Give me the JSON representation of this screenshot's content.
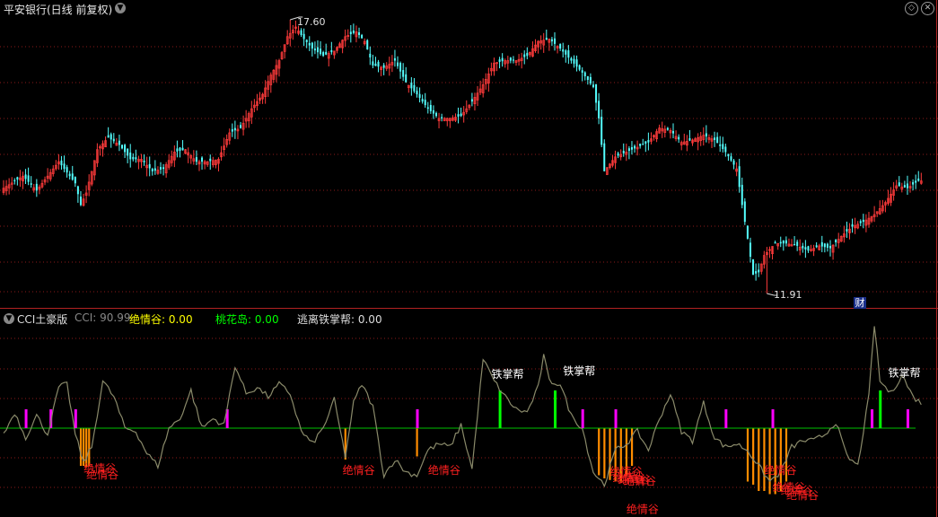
{
  "top": {
    "title": "平安银行(日线 前复权)",
    "high_label": "17.60",
    "low_label": "11.91",
    "fin_badge": "财",
    "corner_icons": [
      "diamond-icon",
      "close-icon"
    ]
  },
  "indicator": {
    "name": "CCI土豪版",
    "cci_label": "CCI: 90.99",
    "jqg_label": "绝情谷: 0.00",
    "thd_label": "桃花岛: 0.00",
    "tzb_label": "逃离铁掌帮: 0.00",
    "annot_jqg": "绝情谷",
    "annot_tzb": "铁掌帮"
  },
  "colors": {
    "bg": "#000000",
    "up": "#ff3b3b",
    "down": "#54ffff",
    "grid": "#8b1a1a",
    "cci_line": "#8a8a6a",
    "zero_line": "#00c000",
    "magenta": "#ff00ff",
    "green_bar": "#00ff00",
    "orange_bar": "#ff8c00",
    "jqg_text": "#ff2020",
    "tzb_text": "#ffffff",
    "cci_text": "#888888",
    "jqg_hdr": "#ffff00",
    "thd_hdr": "#00ff00",
    "tzb_hdr": "#dddddd"
  },
  "chart_data": {
    "type": "candlestick",
    "price_extremes": {
      "high": 17.6,
      "low": 11.91
    },
    "price_anchors": [
      [
        0,
        14.1
      ],
      [
        7,
        14.35
      ],
      [
        12,
        14.05
      ],
      [
        16,
        14.35
      ],
      [
        20,
        14.65
      ],
      [
        22,
        14.5
      ],
      [
        26,
        14.2
      ],
      [
        28,
        13.75
      ],
      [
        30,
        14.0
      ],
      [
        34,
        14.9
      ],
      [
        38,
        15.15
      ],
      [
        42,
        15.0
      ],
      [
        46,
        14.7
      ],
      [
        50,
        14.7
      ],
      [
        54,
        14.45
      ],
      [
        58,
        14.5
      ],
      [
        62,
        14.85
      ],
      [
        66,
        14.9
      ],
      [
        70,
        14.65
      ],
      [
        74,
        14.65
      ],
      [
        78,
        14.7
      ],
      [
        82,
        15.25
      ],
      [
        86,
        15.35
      ],
      [
        90,
        15.75
      ],
      [
        94,
        16.05
      ],
      [
        97,
        16.45
      ],
      [
        100,
        16.75
      ],
      [
        103,
        17.25
      ],
      [
        106,
        17.45
      ],
      [
        109,
        17.2
      ],
      [
        112,
        17.0
      ],
      [
        116,
        16.85
      ],
      [
        120,
        16.95
      ],
      [
        124,
        17.25
      ],
      [
        128,
        17.35
      ],
      [
        131,
        17.15
      ],
      [
        134,
        16.65
      ],
      [
        138,
        16.6
      ],
      [
        142,
        16.75
      ],
      [
        146,
        16.3
      ],
      [
        150,
        16.05
      ],
      [
        154,
        15.75
      ],
      [
        158,
        15.55
      ],
      [
        162,
        15.55
      ],
      [
        166,
        15.6
      ],
      [
        170,
        15.9
      ],
      [
        174,
        16.25
      ],
      [
        178,
        16.7
      ],
      [
        182,
        16.75
      ],
      [
        186,
        16.75
      ],
      [
        190,
        16.85
      ],
      [
        194,
        17.15
      ],
      [
        198,
        17.2
      ],
      [
        202,
        17.0
      ],
      [
        206,
        16.75
      ],
      [
        210,
        16.5
      ],
      [
        214,
        16.2
      ],
      [
        216,
        15.55
      ],
      [
        218,
        14.45
      ],
      [
        222,
        14.75
      ],
      [
        226,
        14.85
      ],
      [
        230,
        14.95
      ],
      [
        234,
        15.05
      ],
      [
        238,
        15.35
      ],
      [
        242,
        15.3
      ],
      [
        246,
        15.05
      ],
      [
        250,
        15.1
      ],
      [
        254,
        15.2
      ],
      [
        258,
        15.1
      ],
      [
        262,
        14.85
      ],
      [
        266,
        14.5
      ],
      [
        268,
        13.75
      ],
      [
        270,
        13.05
      ],
      [
        272,
        12.3
      ],
      [
        274,
        12.35
      ],
      [
        276,
        12.7
      ],
      [
        280,
        12.95
      ],
      [
        284,
        12.95
      ],
      [
        288,
        12.9
      ],
      [
        292,
        12.8
      ],
      [
        296,
        12.9
      ],
      [
        300,
        12.85
      ],
      [
        304,
        13.1
      ],
      [
        308,
        13.3
      ],
      [
        312,
        13.4
      ],
      [
        316,
        13.55
      ],
      [
        320,
        13.8
      ],
      [
        324,
        14.15
      ],
      [
        328,
        14.1
      ],
      [
        332,
        14.25
      ]
    ],
    "cci_anchors": [
      [
        0,
        -20
      ],
      [
        4,
        50
      ],
      [
        8,
        -30
      ],
      [
        12,
        40
      ],
      [
        16,
        -20
      ],
      [
        20,
        130
      ],
      [
        23,
        140
      ],
      [
        26,
        -20
      ],
      [
        29,
        -110
      ],
      [
        32,
        -60
      ],
      [
        36,
        150
      ],
      [
        40,
        100
      ],
      [
        44,
        0
      ],
      [
        48,
        -10
      ],
      [
        52,
        -80
      ],
      [
        56,
        -120
      ],
      [
        60,
        0
      ],
      [
        64,
        30
      ],
      [
        68,
        120
      ],
      [
        72,
        0
      ],
      [
        76,
        30
      ],
      [
        80,
        10
      ],
      [
        84,
        200
      ],
      [
        88,
        110
      ],
      [
        92,
        130
      ],
      [
        96,
        100
      ],
      [
        100,
        140
      ],
      [
        104,
        110
      ],
      [
        108,
        -10
      ],
      [
        112,
        -50
      ],
      [
        116,
        0
      ],
      [
        120,
        90
      ],
      [
        124,
        -90
      ],
      [
        127,
        80
      ],
      [
        130,
        140
      ],
      [
        134,
        70
      ],
      [
        138,
        -150
      ],
      [
        142,
        -100
      ],
      [
        146,
        -140
      ],
      [
        150,
        -150
      ],
      [
        154,
        -70
      ],
      [
        158,
        -50
      ],
      [
        162,
        -60
      ],
      [
        166,
        10
      ],
      [
        170,
        -130
      ],
      [
        174,
        220
      ],
      [
        178,
        150
      ],
      [
        182,
        100
      ],
      [
        186,
        60
      ],
      [
        190,
        50
      ],
      [
        194,
        130
      ],
      [
        196,
        230
      ],
      [
        198,
        150
      ],
      [
        202,
        140
      ],
      [
        206,
        40
      ],
      [
        210,
        0
      ],
      [
        214,
        -140
      ],
      [
        218,
        -180
      ],
      [
        222,
        -70
      ],
      [
        226,
        -50
      ],
      [
        230,
        -10
      ],
      [
        234,
        -70
      ],
      [
        238,
        30
      ],
      [
        242,
        110
      ],
      [
        246,
        -10
      ],
      [
        250,
        -40
      ],
      [
        254,
        80
      ],
      [
        258,
        -30
      ],
      [
        262,
        -60
      ],
      [
        266,
        -50
      ],
      [
        270,
        -70
      ],
      [
        274,
        -120
      ],
      [
        278,
        -170
      ],
      [
        282,
        -140
      ],
      [
        286,
        -60
      ],
      [
        290,
        -40
      ],
      [
        294,
        -40
      ],
      [
        298,
        -20
      ],
      [
        302,
        20
      ],
      [
        306,
        -90
      ],
      [
        310,
        -120
      ],
      [
        314,
        100
      ],
      [
        316,
        330
      ],
      [
        318,
        150
      ],
      [
        322,
        110
      ],
      [
        326,
        170
      ],
      [
        330,
        100
      ],
      [
        333,
        80
      ]
    ],
    "cci_value": 90.99,
    "jqg_bars": [
      [
        28,
        -120
      ],
      [
        29,
        -120
      ],
      [
        30,
        -125
      ],
      [
        31,
        -120
      ],
      [
        124,
        -100
      ],
      [
        150,
        -90
      ],
      [
        216,
        -150
      ],
      [
        218,
        -160
      ],
      [
        220,
        -165
      ],
      [
        222,
        -170
      ],
      [
        224,
        -170
      ],
      [
        226,
        -150
      ],
      [
        228,
        -120
      ],
      [
        270,
        -170
      ],
      [
        272,
        -180
      ],
      [
        274,
        -200
      ],
      [
        276,
        -200
      ],
      [
        278,
        -210
      ],
      [
        280,
        -210
      ],
      [
        282,
        -200
      ],
      [
        284,
        -170
      ]
    ],
    "magenta_bars": [
      8,
      17,
      26,
      81,
      150,
      210,
      222,
      262,
      279,
      315,
      328
    ],
    "green_bars": [
      180,
      200,
      318
    ],
    "jqg_texts": [
      {
        "bar": 30,
        "v": -140
      },
      {
        "bar": 31,
        "v": -160
      },
      {
        "bar": 124,
        "v": -145
      },
      {
        "bar": 155,
        "v": -145
      },
      {
        "bar": 221,
        "v": -150
      },
      {
        "bar": 222,
        "v": -170
      },
      {
        "bar": 224,
        "v": -175
      },
      {
        "bar": 226,
        "v": -180
      },
      {
        "bar": 227,
        "v": -270
      },
      {
        "bar": 277,
        "v": -145
      },
      {
        "bar": 280,
        "v": -200
      },
      {
        "bar": 283,
        "v": -210
      },
      {
        "bar": 285,
        "v": -225
      }
    ],
    "tzb_texts": [
      {
        "bar": 178,
        "v": 160
      },
      {
        "bar": 204,
        "v": 170
      },
      {
        "bar": 322,
        "v": 165
      }
    ],
    "extreme_bars": {
      "high": 104,
      "low": 277
    }
  }
}
